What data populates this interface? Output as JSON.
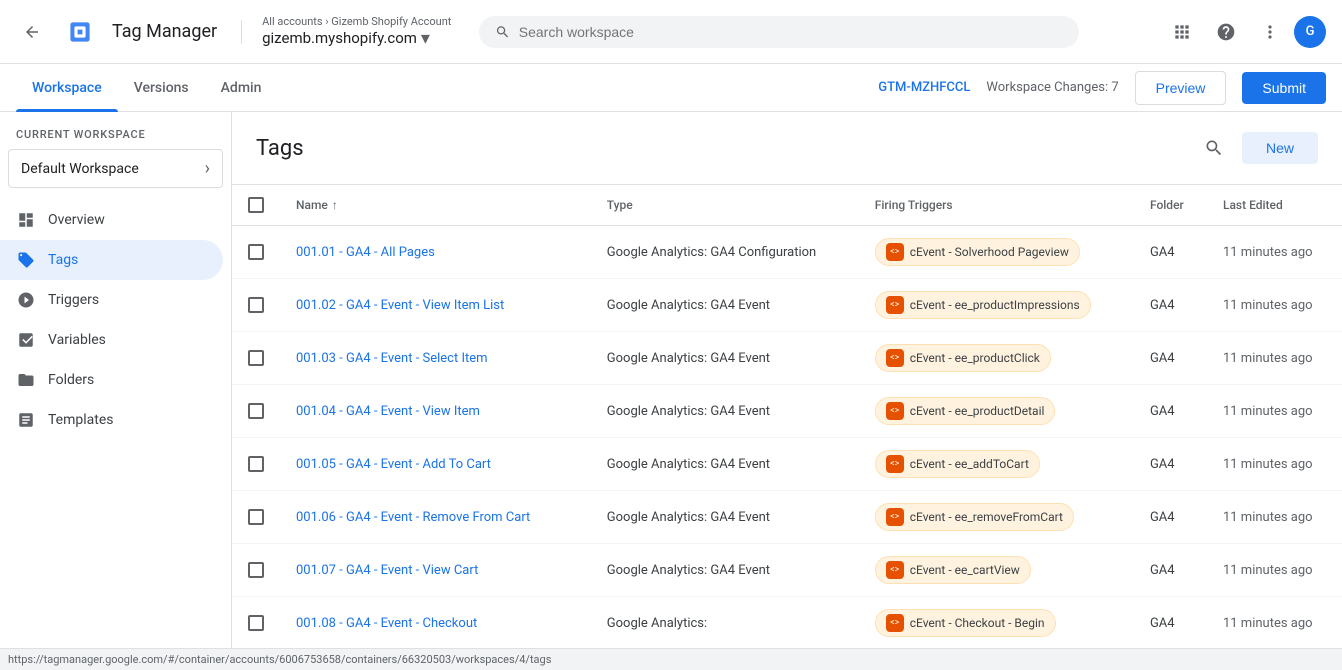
{
  "header": {
    "back_label": "←",
    "logo_alt": "Google Tag Manager logo",
    "title": "Tag Manager",
    "breadcrumb_top": "All accounts › Gizemb Shopify Account",
    "breadcrumb_main": "gizemb.myshopify.com",
    "search_placeholder": "Search workspace",
    "icons": {
      "apps": "⊞",
      "help": "?",
      "more": "⋮"
    },
    "avatar_initials": "G"
  },
  "tabs": [
    {
      "label": "Workspace",
      "active": true
    },
    {
      "label": "Versions",
      "active": false
    },
    {
      "label": "Admin",
      "active": false
    }
  ],
  "tabbar_right": {
    "gtm_id": "GTM-MZHFCCL",
    "workspace_changes": "Workspace Changes: 7",
    "preview_label": "Preview",
    "submit_label": "Submit"
  },
  "sidebar": {
    "current_workspace_label": "CURRENT WORKSPACE",
    "workspace_name": "Default Workspace",
    "nav_items": [
      {
        "label": "Overview",
        "icon": "overview",
        "active": false
      },
      {
        "label": "Tags",
        "icon": "tags",
        "active": true
      },
      {
        "label": "Triggers",
        "icon": "triggers",
        "active": false
      },
      {
        "label": "Variables",
        "icon": "variables",
        "active": false
      },
      {
        "label": "Folders",
        "icon": "folders",
        "active": false
      },
      {
        "label": "Templates",
        "icon": "templates",
        "active": false
      }
    ]
  },
  "content": {
    "title": "Tags",
    "new_label": "New",
    "columns": {
      "name": "Name",
      "type": "Type",
      "firing_triggers": "Firing Triggers",
      "folder": "Folder",
      "last_edited": "Last Edited"
    },
    "tags": [
      {
        "name": "001.01 - GA4 - All Pages",
        "type": "Google Analytics: GA4 Configuration",
        "trigger": "cEvent - Solverhood Pageview",
        "folder": "GA4",
        "last_edited": "11 minutes ago"
      },
      {
        "name": "001.02 - GA4 - Event - View Item List",
        "type": "Google Analytics: GA4 Event",
        "trigger": "cEvent - ee_productImpressions",
        "folder": "GA4",
        "last_edited": "11 minutes ago"
      },
      {
        "name": "001.03 - GA4 - Event - Select Item",
        "type": "Google Analytics: GA4 Event",
        "trigger": "cEvent - ee_productClick",
        "folder": "GA4",
        "last_edited": "11 minutes ago"
      },
      {
        "name": "001.04 - GA4 - Event - View Item",
        "type": "Google Analytics: GA4 Event",
        "trigger": "cEvent - ee_productDetail",
        "folder": "GA4",
        "last_edited": "11 minutes ago"
      },
      {
        "name": "001.05 - GA4 - Event - Add To Cart",
        "type": "Google Analytics: GA4 Event",
        "trigger": "cEvent - ee_addToCart",
        "folder": "GA4",
        "last_edited": "11 minutes ago"
      },
      {
        "name": "001.06 - GA4 - Event - Remove From Cart",
        "type": "Google Analytics: GA4 Event",
        "trigger": "cEvent - ee_removeFromCart",
        "folder": "GA4",
        "last_edited": "11 minutes ago"
      },
      {
        "name": "001.07 - GA4 - Event - View Cart",
        "type": "Google Analytics: GA4 Event",
        "trigger": "cEvent - ee_cartView",
        "folder": "GA4",
        "last_edited": "11 minutes ago"
      },
      {
        "name": "001.08 - GA4 - Event - Checkout",
        "type": "Google Analytics:",
        "trigger": "cEvent - Checkout - Begin",
        "folder": "GA4",
        "last_edited": "11 minutes ago"
      }
    ]
  },
  "status_bar": {
    "url": "https://tagmanager.google.com/#/container/accounts/6006753658/containers/66320503/workspaces/4/tags"
  }
}
